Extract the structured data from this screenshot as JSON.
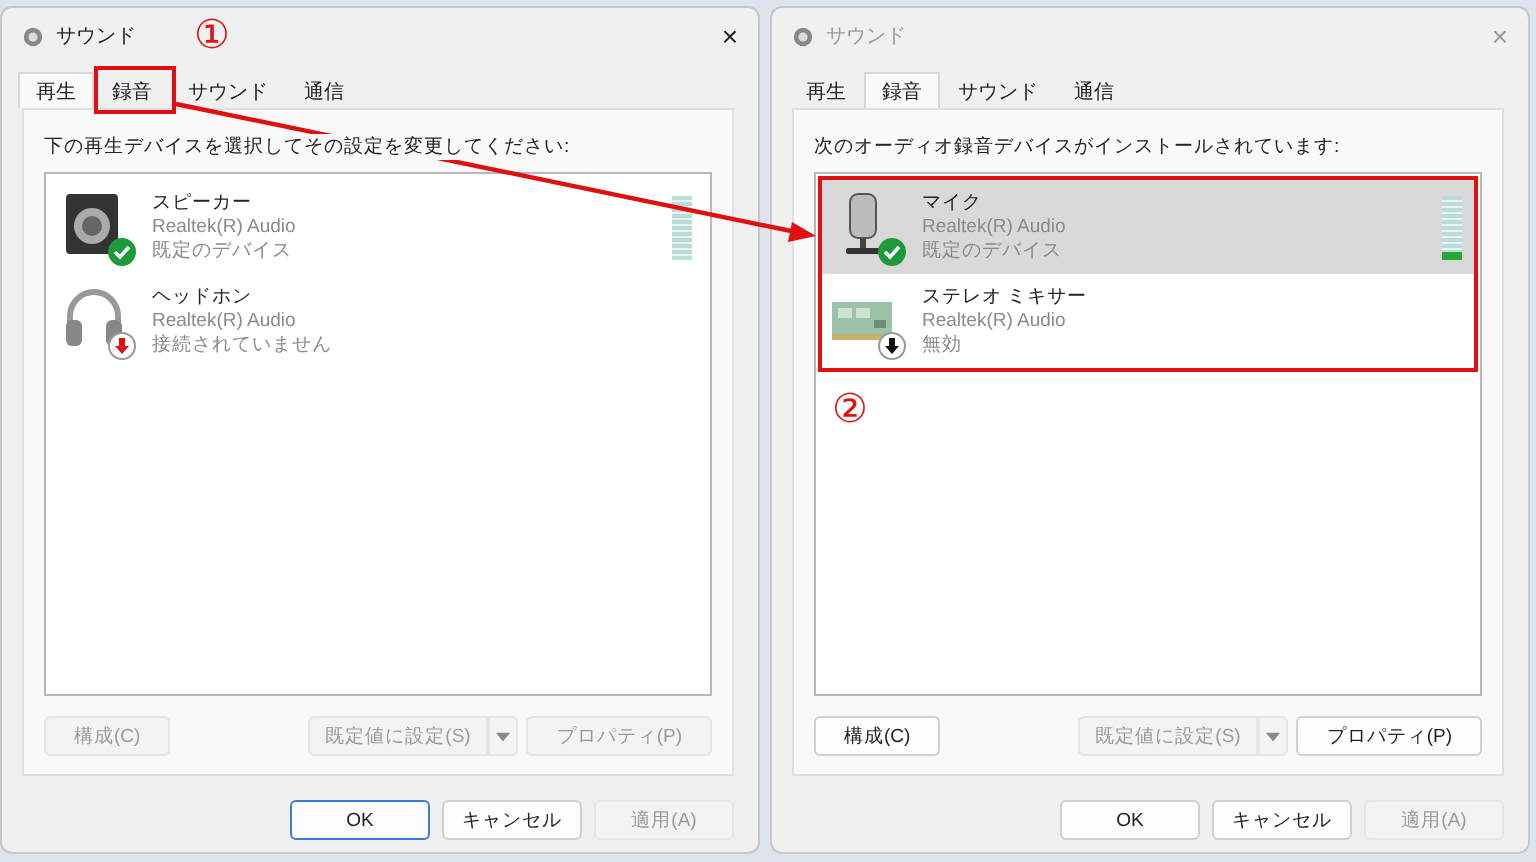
{
  "annotations": [
    {
      "label": "①"
    },
    {
      "label": "②"
    }
  ],
  "dialogs": [
    {
      "title": "サウンド",
      "active": true,
      "close": "×",
      "tabs": [
        {
          "label": "再生",
          "selected": true,
          "highlighted": false
        },
        {
          "label": "録音",
          "selected": false,
          "highlighted": true
        },
        {
          "label": "サウンド",
          "selected": false,
          "highlighted": false
        },
        {
          "label": "通信",
          "selected": false,
          "highlighted": false
        }
      ],
      "instruction": "下の再生デバイスを選択してその設定を変更してください:",
      "list_highlighted": false,
      "devices": [
        {
          "kind": "speaker",
          "name": "スピーカー",
          "driver": "Realtek(R) Audio",
          "status": "既定のデバイス",
          "badge": {
            "kind": "default"
          },
          "selected": false,
          "meter": {
            "level": 0
          }
        },
        {
          "kind": "headphones",
          "name": "ヘッドホン",
          "driver": "Realtek(R) Audio",
          "status": "接続されていません",
          "badge": {
            "kind": "unplugged"
          },
          "selected": false
        }
      ],
      "buttons": [
        {
          "label": "構成(C)",
          "disabled": true
        },
        {
          "label": "既定値に設定(S)",
          "disabled": true,
          "split": true
        },
        {
          "label": "プロパティ(P)",
          "disabled": true
        }
      ],
      "footer": [
        {
          "label": "OK",
          "disabled": false,
          "default": true
        },
        {
          "label": "キャンセル",
          "disabled": false,
          "default": false
        },
        {
          "label": "適用(A)",
          "disabled": true,
          "default": false
        }
      ]
    },
    {
      "title": "サウンド",
      "active": false,
      "close": "×",
      "tabs": [
        {
          "label": "再生",
          "selected": false,
          "highlighted": false
        },
        {
          "label": "録音",
          "selected": true,
          "highlighted": false
        },
        {
          "label": "サウンド",
          "selected": false,
          "highlighted": false
        },
        {
          "label": "通信",
          "selected": false,
          "highlighted": false
        }
      ],
      "instruction": "次のオーディオ録音デバイスがインストールされています:",
      "list_highlighted": true,
      "devices": [
        {
          "kind": "microphone",
          "name": "マイク",
          "driver": "Realtek(R) Audio",
          "status": "既定のデバイス",
          "badge": {
            "kind": "default"
          },
          "selected": true,
          "meter": {
            "level": 0.1
          }
        },
        {
          "kind": "mixer",
          "name": "ステレオ ミキサー",
          "driver": "Realtek(R) Audio",
          "status": "無効",
          "badge": {
            "kind": "disabled"
          },
          "selected": false
        }
      ],
      "buttons": [
        {
          "label": "構成(C)",
          "disabled": false
        },
        {
          "label": "既定値に設定(S)",
          "disabled": true,
          "split": true
        },
        {
          "label": "プロパティ(P)",
          "disabled": false
        }
      ],
      "footer": [
        {
          "label": "OK",
          "disabled": false,
          "default": false
        },
        {
          "label": "キャンセル",
          "disabled": false,
          "default": false
        },
        {
          "label": "適用(A)",
          "disabled": true,
          "default": false
        }
      ]
    }
  ]
}
